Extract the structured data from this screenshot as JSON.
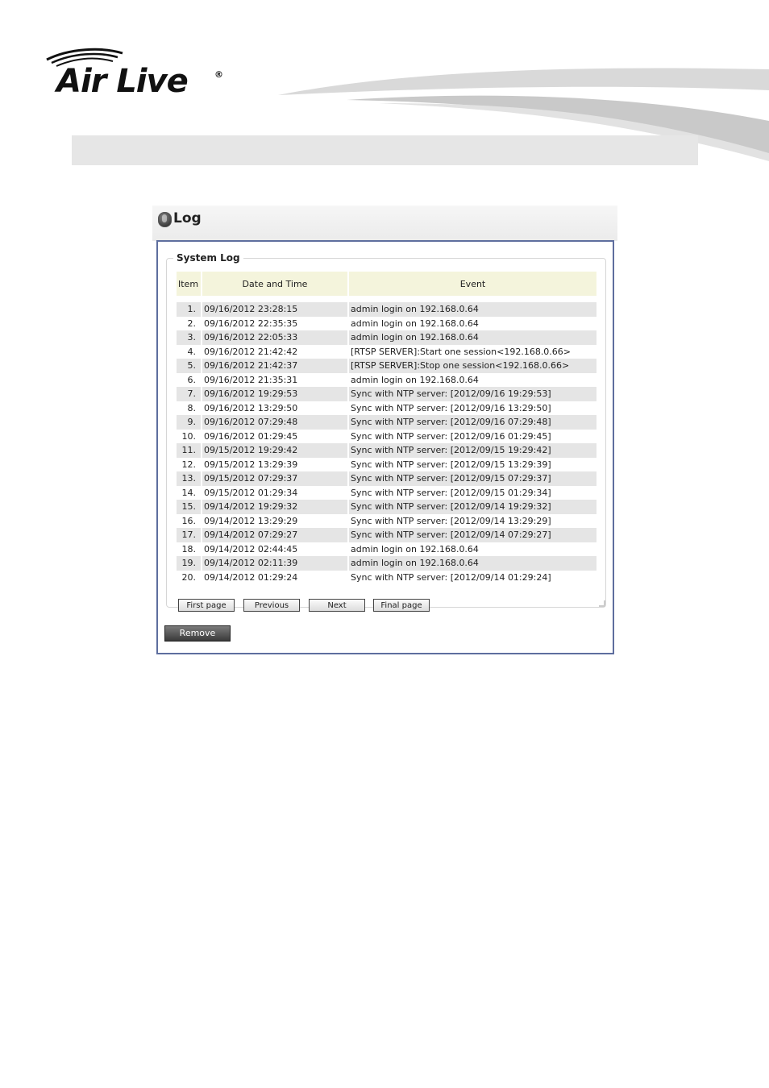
{
  "brand": {
    "logo_text": "Air Live",
    "registered_mark": "®"
  },
  "panel": {
    "title": "Log",
    "section_title": "System Log"
  },
  "table": {
    "columns": [
      "Item",
      "Date and Time",
      "Event"
    ],
    "rows": [
      {
        "item": "1.",
        "datetime": "09/16/2012 23:28:15",
        "event": "admin login on 192.168.0.64"
      },
      {
        "item": "2.",
        "datetime": "09/16/2012 22:35:35",
        "event": "admin login on 192.168.0.64"
      },
      {
        "item": "3.",
        "datetime": "09/16/2012 22:05:33",
        "event": "admin login on 192.168.0.64"
      },
      {
        "item": "4.",
        "datetime": "09/16/2012 21:42:42",
        "event": "[RTSP SERVER]:Start one session<192.168.0.66>"
      },
      {
        "item": "5.",
        "datetime": "09/16/2012 21:42:37",
        "event": "[RTSP SERVER]:Stop one session<192.168.0.66>"
      },
      {
        "item": "6.",
        "datetime": "09/16/2012 21:35:31",
        "event": "admin login on 192.168.0.64"
      },
      {
        "item": "7.",
        "datetime": "09/16/2012 19:29:53",
        "event": "Sync with NTP server: [2012/09/16 19:29:53]"
      },
      {
        "item": "8.",
        "datetime": "09/16/2012 13:29:50",
        "event": "Sync with NTP server: [2012/09/16 13:29:50]"
      },
      {
        "item": "9.",
        "datetime": "09/16/2012 07:29:48",
        "event": "Sync with NTP server: [2012/09/16 07:29:48]"
      },
      {
        "item": "10.",
        "datetime": "09/16/2012 01:29:45",
        "event": "Sync with NTP server: [2012/09/16 01:29:45]"
      },
      {
        "item": "11.",
        "datetime": "09/15/2012 19:29:42",
        "event": "Sync with NTP server: [2012/09/15 19:29:42]"
      },
      {
        "item": "12.",
        "datetime": "09/15/2012 13:29:39",
        "event": "Sync with NTP server: [2012/09/15 13:29:39]"
      },
      {
        "item": "13.",
        "datetime": "09/15/2012 07:29:37",
        "event": "Sync with NTP server: [2012/09/15 07:29:37]"
      },
      {
        "item": "14.",
        "datetime": "09/15/2012 01:29:34",
        "event": "Sync with NTP server: [2012/09/15 01:29:34]"
      },
      {
        "item": "15.",
        "datetime": "09/14/2012 19:29:32",
        "event": "Sync with NTP server: [2012/09/14 19:29:32]"
      },
      {
        "item": "16.",
        "datetime": "09/14/2012 13:29:29",
        "event": "Sync with NTP server: [2012/09/14 13:29:29]"
      },
      {
        "item": "17.",
        "datetime": "09/14/2012 07:29:27",
        "event": "Sync with NTP server: [2012/09/14 07:29:27]"
      },
      {
        "item": "18.",
        "datetime": "09/14/2012 02:44:45",
        "event": "admin login on 192.168.0.64"
      },
      {
        "item": "19.",
        "datetime": "09/14/2012 02:11:39",
        "event": "admin login on 192.168.0.64"
      },
      {
        "item": "20.",
        "datetime": "09/14/2012 01:29:24",
        "event": "Sync with NTP server: [2012/09/14 01:29:24]"
      }
    ]
  },
  "pager": {
    "first": "First page",
    "previous": "Previous",
    "next": "Next",
    "final": "Final page"
  },
  "actions": {
    "remove": "Remove"
  },
  "icons": {
    "log": "log-icon",
    "swoosh": "header-swoosh-graphic"
  },
  "colors": {
    "panel_border": "#5e6e9e",
    "header_cell": "#f4f4dc",
    "odd_row": "#e5e5e5",
    "band": "#e6e6e6"
  }
}
